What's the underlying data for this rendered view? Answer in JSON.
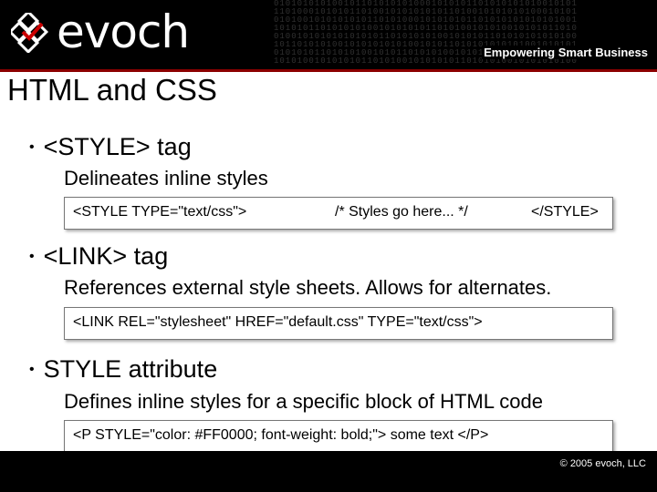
{
  "header": {
    "logo_text": "evoch",
    "tagline": "Empowering Smart Business",
    "binary_lines": [
      "0101010101001011010101010001010101101010101010010101",
      "1101000101010110100101010101011010010101010100010101",
      "0101001010101010110101000101010101101010101010101001",
      "1010101101010101001010101011010100101010010101011010",
      "0100101010101010101101010101001010101101010101010100",
      "1011010101001010101010100101011010101010101001010101",
      "0101010110101010010101101010100101010100101010101011",
      "1010100101010101101010010101010110101010010101010100"
    ]
  },
  "slide": {
    "title": "HTML and CSS",
    "sections": [
      {
        "bullet": "<STYLE> tag",
        "description": "Delineates inline styles",
        "code_parts": [
          "<STYLE TYPE=\"text/css\">",
          "/* Styles go here... */",
          "</STYLE>"
        ]
      },
      {
        "bullet": "<LINK> tag",
        "description": "References external style sheets.  Allows for alternates.",
        "code": "<LINK REL=\"stylesheet\" HREF=\"default.css\" TYPE=\"text/css\">"
      },
      {
        "bullet": "STYLE attribute",
        "description": "Defines inline styles for a specific block of HTML code",
        "code": "<P STYLE=\"color: #FF0000; font-weight: bold;\"> some text </P>"
      }
    ]
  },
  "footer": {
    "copyright": "© 2005 evoch, LLC"
  }
}
